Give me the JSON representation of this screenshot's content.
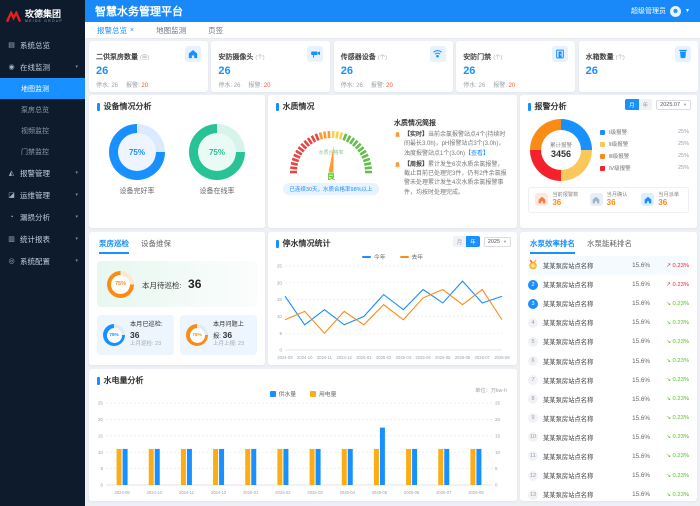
{
  "brand": {
    "name": "玫德集团",
    "subtitle": "MEIDE GROUP"
  },
  "header": {
    "title": "智慧水务管理平台",
    "user": "超级管理员"
  },
  "tabbar": {
    "tabs": [
      {
        "label": "报警总览",
        "active": true,
        "closable": true
      },
      {
        "label": "地图监测",
        "active": false,
        "closable": false
      },
      {
        "label": "页签",
        "active": false,
        "closable": false
      }
    ]
  },
  "sidebar": {
    "items": [
      {
        "label": "系统总览",
        "icon": "overview-icon",
        "glyph": "▤",
        "children": []
      },
      {
        "label": "在线监测",
        "icon": "monitor-icon",
        "glyph": "◉",
        "expanded": true,
        "children": [
          {
            "label": "地图监测",
            "active": true
          },
          {
            "label": "泵房总览",
            "active": false
          },
          {
            "label": "视频监控",
            "active": false
          },
          {
            "label": "门禁监控",
            "active": false
          }
        ]
      },
      {
        "label": "报警管理",
        "icon": "alarm-icon",
        "glyph": "◭",
        "collapsible": true,
        "children": []
      },
      {
        "label": "运维管理",
        "icon": "ops-icon",
        "glyph": "◪",
        "collapsible": true,
        "children": []
      },
      {
        "label": "漏损分析",
        "icon": "analysis-icon",
        "glyph": "◔",
        "collapsible": true,
        "children": []
      },
      {
        "label": "统计报表",
        "icon": "report-icon",
        "glyph": "▥",
        "collapsible": true,
        "children": []
      },
      {
        "label": "系统配置",
        "icon": "settings-icon",
        "glyph": "◎",
        "collapsible": true,
        "children": []
      }
    ]
  },
  "kpis": [
    {
      "label": "二供泵房数量",
      "unit": "(座)",
      "value": "26",
      "icon": "pump-house-icon",
      "stats": [
        {
          "k": "停水:",
          "v": "26",
          "alert": false
        },
        {
          "k": "报警:",
          "v": "20",
          "alert": true
        }
      ]
    },
    {
      "label": "安防摄像头",
      "unit": "(个)",
      "value": "26",
      "icon": "camera-icon",
      "stats": [
        {
          "k": "停水:",
          "v": "26",
          "alert": false
        },
        {
          "k": "报警:",
          "v": "20",
          "alert": true
        }
      ]
    },
    {
      "label": "传感器设备",
      "unit": "(个)",
      "value": "26",
      "icon": "sensor-icon",
      "stats": [
        {
          "k": "停水:",
          "v": "26",
          "alert": false
        },
        {
          "k": "报警:",
          "v": "20",
          "alert": true
        }
      ]
    },
    {
      "label": "安防门禁",
      "unit": "(个)",
      "value": "26",
      "icon": "door-icon",
      "stats": [
        {
          "k": "停水:",
          "v": "26",
          "alert": false
        },
        {
          "k": "报警:",
          "v": "20",
          "alert": true
        }
      ]
    },
    {
      "label": "水箱数量",
      "unit": "(个)",
      "value": "26",
      "icon": "tank-icon",
      "stats": []
    }
  ],
  "device_analysis": {
    "title": "设备情况分析",
    "rings": [
      {
        "value": 75,
        "text": "75%",
        "label": "设备完好率",
        "color": "#1890ff",
        "track": "#dceaff",
        "inner": "#eef5ff"
      },
      {
        "value": 75,
        "text": "75%",
        "label": "设备在线率",
        "color": "#27c295",
        "track": "#d8f4ea",
        "inner": "#eafaf4"
      }
    ]
  },
  "water_quality": {
    "title": "水质情况",
    "gauge_label": "水质合格率",
    "grade": "良",
    "footer": "已连续30天，水质合格率98%以上",
    "brief_title": "水质情况简报",
    "items": [
      {
        "tag": "【实时】",
        "text": "当前余氯报警站点4个(持续时间最长3.0h)，pH报警站点3个(3.0h)，浊度报警站点1个(3.0h)",
        "link": "【查看】"
      },
      {
        "tag": "【周报】",
        "text": "累计发生6次水质余氯报警，截止目前已处理完3件，仍有2件余氯报警未处理累计发生4次水质余氯报警事件，均按时处理完成。",
        "link": ""
      }
    ]
  },
  "alarm_analysis": {
    "title": "报警分析",
    "toggle": [
      "月",
      "年"
    ],
    "active_toggle": "月",
    "period": "2025.07",
    "center_label": "累计报警",
    "center_value": "3456",
    "legend": [
      {
        "label": "Ⅰ级报警",
        "pct": "25%",
        "color": "#1890ff"
      },
      {
        "label": "Ⅱ级报警",
        "pct": "25%",
        "color": "#fac858"
      },
      {
        "label": "Ⅲ级报警",
        "pct": "25%",
        "color": "#fa8c16"
      },
      {
        "label": "Ⅳ级报警",
        "pct": "25%",
        "color": "#f5222d"
      }
    ],
    "stats": [
      {
        "label": "当前报警数",
        "value": "36",
        "color": "#fa7a45",
        "bg": "#fdeade"
      },
      {
        "label": "当月确认",
        "value": "36",
        "color": "#9db3d0",
        "bg": "#e9eef6"
      },
      {
        "label": "当月派单",
        "value": "36",
        "color": "#1890ff",
        "bg": "#ddefff"
      }
    ]
  },
  "inspection": {
    "tabs": [
      "泵房巡检",
      "设备维保"
    ],
    "active_tab": "泵房巡检",
    "main": {
      "value": 75,
      "text": "75%",
      "color": "#fa8c16",
      "label": "本月待巡检:",
      "count": "36"
    },
    "subs": [
      {
        "value": 75,
        "text": "75%",
        "color": "#1890ff",
        "label": "本月已巡检:",
        "count": "36",
        "sub": "上月巡检: 23"
      },
      {
        "value": 75,
        "text": "75%",
        "color": "#fa8c16",
        "label": "本月问题上报:",
        "count": "36",
        "sub": "上月上报: 23"
      }
    ]
  },
  "outage": {
    "title": "停水情况统计",
    "toggle": [
      "月",
      "年"
    ],
    "active_toggle": "年",
    "period": "2025"
  },
  "energy": {
    "title": "水电量分析",
    "unit": "单位：万kw·h"
  },
  "ranking": {
    "tabs": [
      "水泵效率排名",
      "水泵能耗排名"
    ],
    "active_tab": "水泵效率排名",
    "rows": [
      {
        "rank": 1,
        "name": "某某泵房站点名称",
        "value": "15.6%",
        "change": "0.23%",
        "dir": "up"
      },
      {
        "rank": 2,
        "name": "某某泵房站点名称",
        "value": "15.6%",
        "change": "0.23%",
        "dir": "up"
      },
      {
        "rank": 3,
        "name": "某某泵房站点名称",
        "value": "15.6%",
        "change": "0.23%",
        "dir": "down"
      },
      {
        "rank": 4,
        "name": "某某泵房站点名称",
        "value": "15.6%",
        "change": "0.23%",
        "dir": "down"
      },
      {
        "rank": 5,
        "name": "某某泵房站点名称",
        "value": "15.6%",
        "change": "0.23%",
        "dir": "down"
      },
      {
        "rank": 6,
        "name": "某某泵房站点名称",
        "value": "15.6%",
        "change": "0.23%",
        "dir": "down"
      },
      {
        "rank": 7,
        "name": "某某泵房站点名称",
        "value": "15.6%",
        "change": "0.23%",
        "dir": "down"
      },
      {
        "rank": 8,
        "name": "某某泵房站点名称",
        "value": "15.6%",
        "change": "0.23%",
        "dir": "down"
      },
      {
        "rank": 9,
        "name": "某某泵房站点名称",
        "value": "15.6%",
        "change": "0.23%",
        "dir": "down"
      },
      {
        "rank": 10,
        "name": "某某泵房站点名称",
        "value": "15.6%",
        "change": "0.23%",
        "dir": "down"
      },
      {
        "rank": 11,
        "name": "某某泵房站点名称",
        "value": "15.6%",
        "change": "0.23%",
        "dir": "down"
      },
      {
        "rank": 12,
        "name": "某某泵房站点名称",
        "value": "15.6%",
        "change": "0.23%",
        "dir": "down"
      },
      {
        "rank": 13,
        "name": "某某泵房站点名称",
        "value": "15.6%",
        "change": "0.23%",
        "dir": "down"
      }
    ]
  },
  "chart_data": [
    {
      "id": "outage",
      "type": "line",
      "title": "停水情况统计",
      "categories": [
        "2024-09",
        "2024-10",
        "2024-11",
        "2024-12",
        "2025-01",
        "2025-02",
        "2025-03",
        "2025-04",
        "2025-05",
        "2025-06",
        "2025-07",
        "2025-08"
      ],
      "series": [
        {
          "name": "今年",
          "color": "#1890ff",
          "values": [
            16,
            7.5,
            12,
            7.5,
            10,
            16.5,
            12,
            18,
            14,
            20.5,
            14,
            16
          ]
        },
        {
          "name": "去年",
          "color": "#fa8c16",
          "values": [
            9,
            11.5,
            5,
            11.5,
            7.5,
            13.5,
            9,
            15.5,
            18,
            13.5,
            18,
            9
          ]
        }
      ],
      "ylim": [
        0,
        25
      ],
      "yticks": [
        0,
        5,
        10,
        15,
        20,
        25
      ],
      "grid": true,
      "legend_position": "top"
    },
    {
      "id": "energy",
      "type": "bar",
      "title": "水电量分析",
      "categories": [
        "2024-09",
        "2024-10",
        "2024-11",
        "2024-12",
        "2025-01",
        "2025-02",
        "2025-03",
        "2025-04",
        "2025-05",
        "2025-06",
        "2025-07",
        "2025-08"
      ],
      "series": [
        {
          "name": "供水量",
          "color": "#1890ff",
          "values": [
            11,
            11,
            11,
            11,
            11,
            11,
            11,
            11,
            17.5,
            11,
            11,
            11
          ]
        },
        {
          "name": "用电量",
          "color": "#faad14",
          "values": [
            11,
            11,
            11,
            11,
            11,
            11,
            11,
            11,
            11,
            11,
            11,
            11
          ]
        }
      ],
      "ylim": [
        0,
        25
      ],
      "yticks": [
        0,
        5,
        10,
        15,
        20,
        25
      ],
      "grid": true,
      "legend_position": "top",
      "ylabel": "单位：万kw·h"
    },
    {
      "id": "alarm_donut",
      "type": "pie",
      "center_label": "累计报警",
      "center_value": 3456,
      "slices": [
        {
          "label": "Ⅰ级报警",
          "pct": 25,
          "color": "#1890ff"
        },
        {
          "label": "Ⅱ级报警",
          "pct": 25,
          "color": "#fac858"
        },
        {
          "label": "Ⅳ级报警",
          "pct": 25,
          "color": "#f5222d"
        },
        {
          "label": "Ⅲ级报警",
          "pct": 25,
          "color": "#fa8c16"
        }
      ]
    },
    {
      "id": "quality_gauge",
      "type": "gauge",
      "label": "水质合格率",
      "grade": "良",
      "note": "已连续30天，水质合格率98%以上"
    }
  ]
}
